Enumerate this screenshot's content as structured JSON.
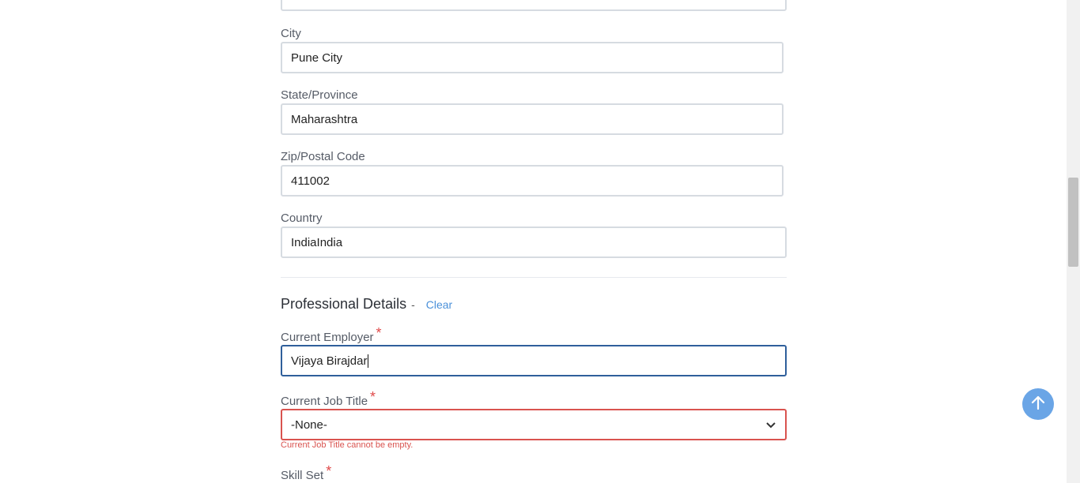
{
  "form": {
    "top_partial_value": "...",
    "city": {
      "label": "City",
      "value": "Pune City"
    },
    "state": {
      "label": "State/Province",
      "value": "Maharashtra"
    },
    "zip": {
      "label": "Zip/Postal Code",
      "value": "411002"
    },
    "country": {
      "label": "Country",
      "value": "IndiaIndia"
    }
  },
  "professional": {
    "title": "Professional Details",
    "dash": "-",
    "clear_label": "Clear",
    "employer": {
      "label": "Current Employer",
      "required_mark": "*",
      "value": "Vijaya Birajdar"
    },
    "job_title": {
      "label": "Current Job Title",
      "required_mark": "*",
      "selected": "-None-",
      "error": "Current Job Title cannot be empty."
    },
    "skill_set": {
      "label": "Skill Set",
      "required_mark": "*"
    }
  },
  "icons": {
    "scroll_top": "arrow-up-icon",
    "dropdown": "chevron-down-icon"
  },
  "colors": {
    "accent": "#4a90d9",
    "error": "#d9534f",
    "focus": "#2f5f9b",
    "scroll_top_bg": "#6aa5e6"
  }
}
